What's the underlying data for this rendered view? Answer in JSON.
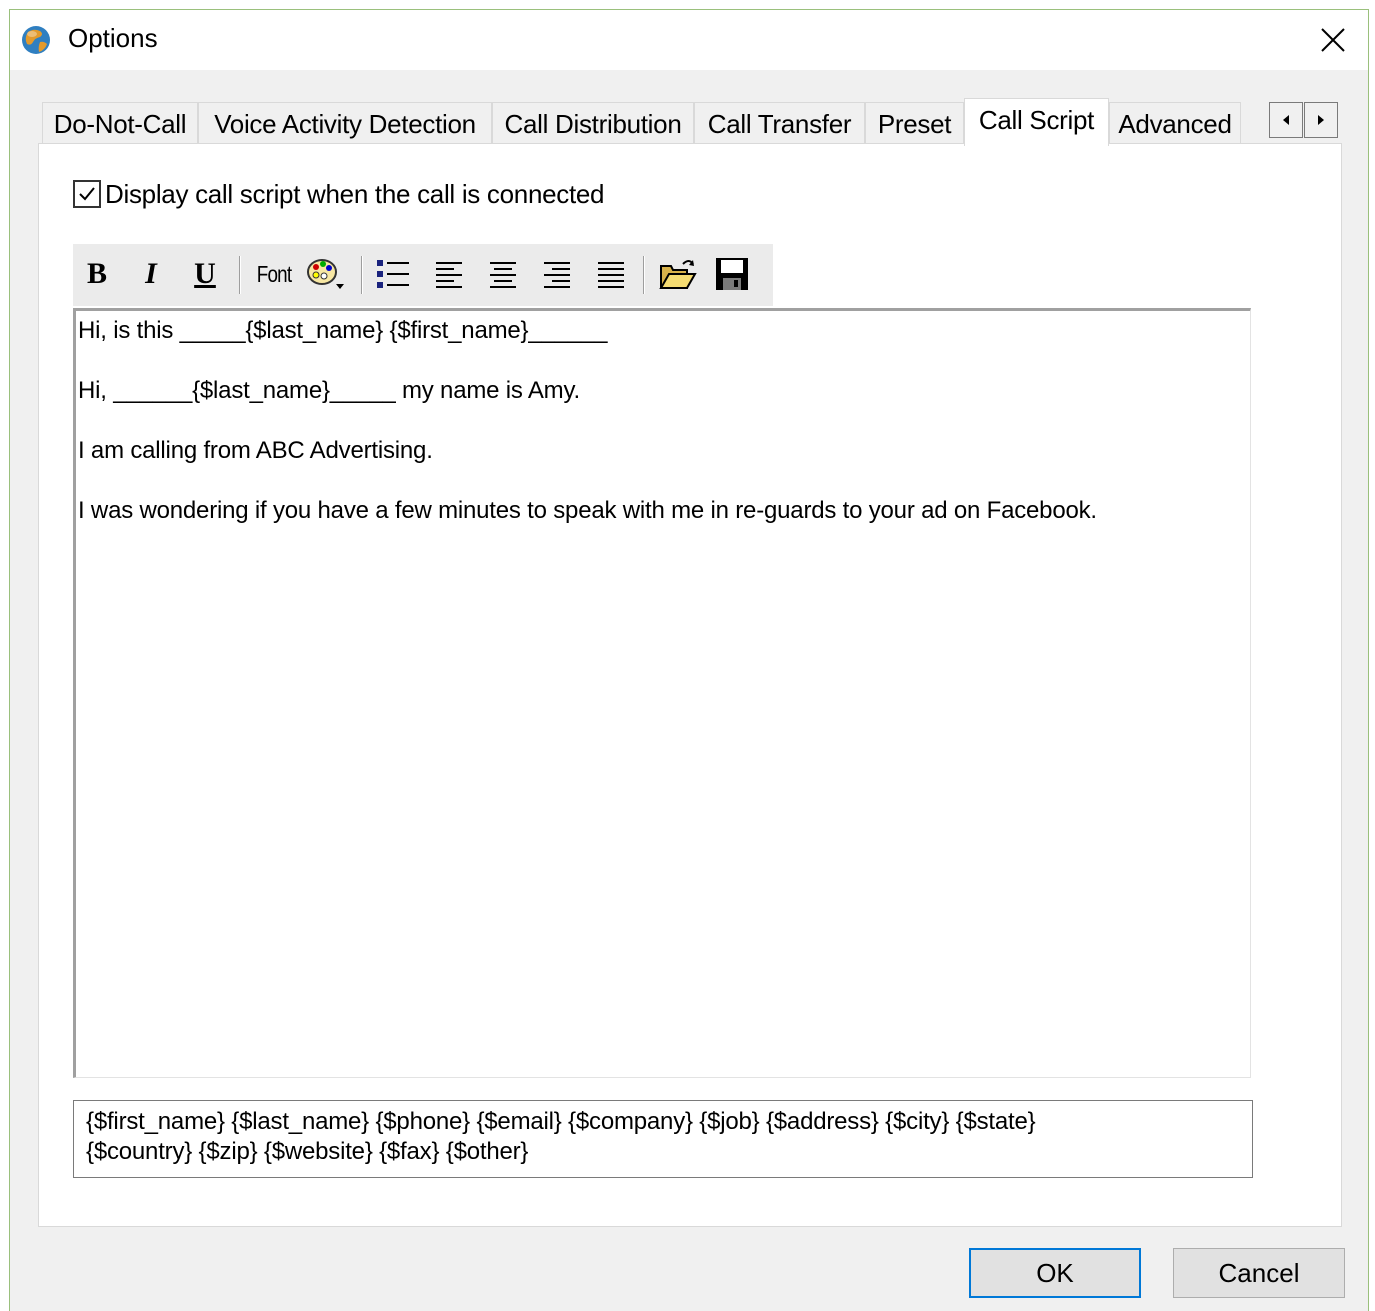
{
  "window": {
    "title": "Options"
  },
  "tabs": [
    {
      "label": "Do-Not-Call"
    },
    {
      "label": "Voice Activity Detection"
    },
    {
      "label": "Call Distribution"
    },
    {
      "label": "Call Transfer"
    },
    {
      "label": "Preset"
    },
    {
      "label": "Call Script",
      "active": true
    },
    {
      "label": "Advanced"
    }
  ],
  "call_script": {
    "display_checkbox_label": "Display call script when the call is connected",
    "display_checkbox_checked": true,
    "toolbar": {
      "bold": "B",
      "italic": "I",
      "underline": "U",
      "font": "Font",
      "icons": [
        "color-palette-icon",
        "bullet-list-icon",
        "align-left-icon",
        "align-center-icon",
        "align-right-icon",
        "justify-icon",
        "open-folder-icon",
        "save-icon"
      ]
    },
    "script_lines": [
      "Hi, is this _____{$last_name} {$first_name}______",
      "Hi,  ______{$last_name}_____ my name is Amy.",
      "I am calling from ABC Advertising.",
      "I was wondering if you have a few minutes to speak with me in re-guards to your ad on Facebook."
    ],
    "variables_line1": "{$first_name} {$last_name} {$phone} {$email} {$company} {$job} {$address} {$city} {$state}",
    "variables_line2": "{$country} {$zip} {$website} {$fax} {$other}"
  },
  "buttons": {
    "ok": "OK",
    "cancel": "Cancel"
  }
}
